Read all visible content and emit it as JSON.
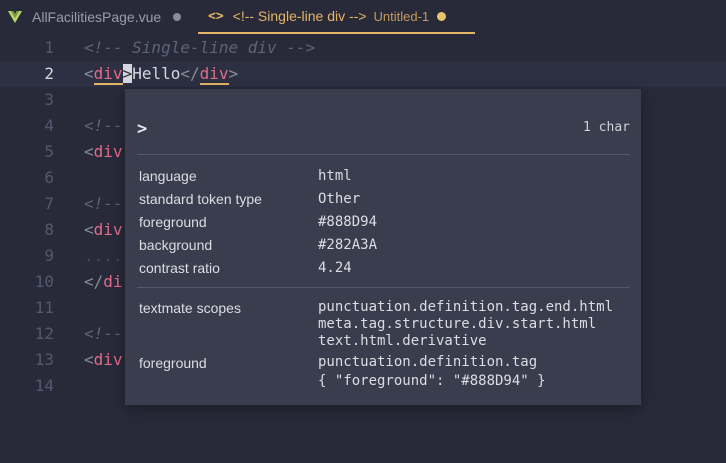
{
  "tabs": [
    {
      "title": "AllFacilitiesPage.vue",
      "modified": true,
      "active": false
    },
    {
      "title": "<!-- Single-line div -->",
      "subtitle": "Untitled-1",
      "modified": true,
      "active": true
    }
  ],
  "editor": {
    "current_line": 2,
    "lines": [
      {
        "number": "1",
        "comment": "<!-- Single-line div -->"
      },
      {
        "number": "2",
        "open_bracket": "<",
        "tag": "div",
        "close_bracket": ">",
        "text": "Hello",
        "end_open": "</",
        "end_tag": "div",
        "end_close": ">"
      },
      {
        "number": "3"
      },
      {
        "number": "4",
        "fragment": "<!--"
      },
      {
        "number": "5",
        "bracket": "<",
        "tag": "div"
      },
      {
        "number": "6"
      },
      {
        "number": "7",
        "fragment": "<!--"
      },
      {
        "number": "8",
        "bracket": "<",
        "tag": "div"
      },
      {
        "number": "9",
        "whitespace": "...."
      },
      {
        "number": "10",
        "bracket": "</",
        "tag": "di"
      },
      {
        "number": "11"
      },
      {
        "number": "12",
        "fragment": "<!--"
      },
      {
        "number": "13",
        "bracket": "<",
        "tag": "div"
      },
      {
        "number": "14"
      }
    ]
  },
  "inspect_hover": {
    "char": ">",
    "char_count": "1 char",
    "rows": [
      {
        "label": "language",
        "value": "html"
      },
      {
        "label": "standard token type",
        "value": "Other"
      },
      {
        "label": "foreground",
        "value": "#888D94"
      },
      {
        "label": "background",
        "value": "#282A3A"
      },
      {
        "label": "contrast ratio",
        "value": "4.24"
      }
    ],
    "textmate_scopes_label": "textmate scopes",
    "textmate_scopes": [
      "punctuation.definition.tag.end.html",
      "meta.tag.structure.div.start.html",
      "text.html.derivative"
    ],
    "theme_foreground_label": "foreground",
    "theme_foreground_rule": [
      "punctuation.definition.tag",
      "{ \"foreground\": \"#888D94\" }"
    ]
  },
  "colors": {
    "background": "#282A3A",
    "punctuation": "#888D94",
    "tag": "#E06C88",
    "accent": "#E5B567",
    "vue_icon": "#B8D86B"
  }
}
